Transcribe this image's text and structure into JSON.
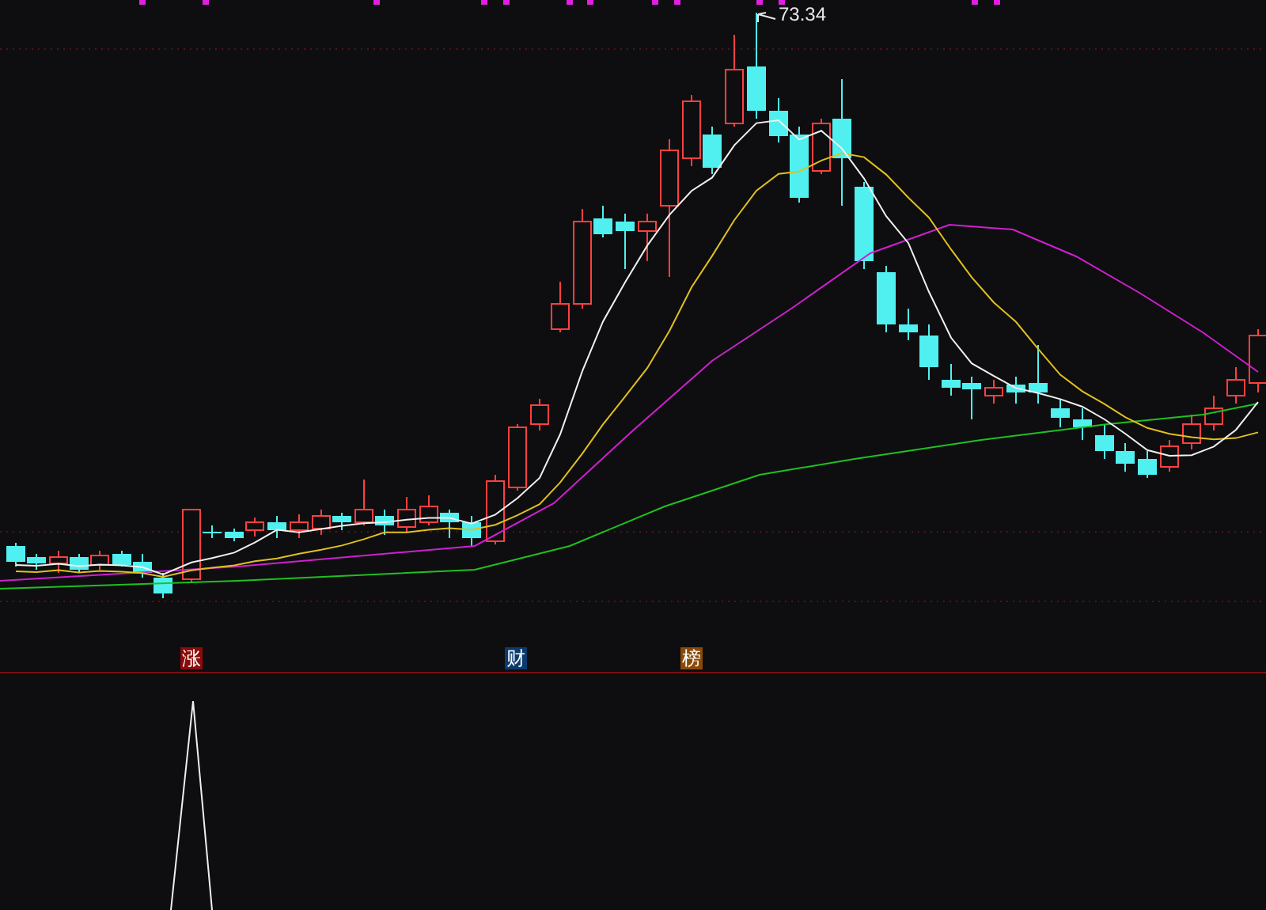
{
  "price_chart": {
    "high_label": "73.34"
  },
  "event_markers": [
    {
      "text": "涨",
      "color": "#8b0a0a"
    },
    {
      "text": "财",
      "color": "#0b3a6e"
    },
    {
      "text": "榜",
      "color": "#8a4a06"
    }
  ]
}
